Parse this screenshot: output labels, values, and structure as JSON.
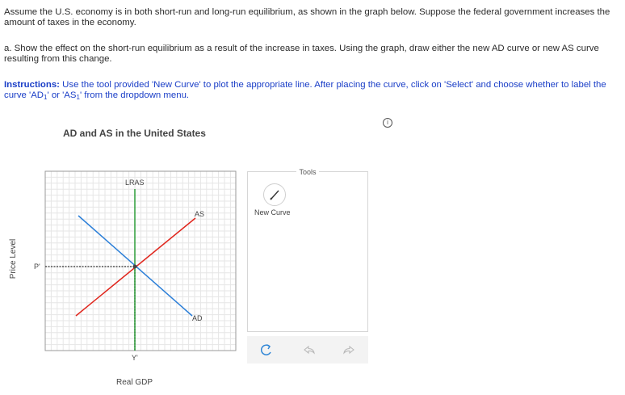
{
  "question": {
    "intro": "Assume the U.S. economy is in both short-run and long-run equilibrium, as shown in the graph below. Suppose the federal government increases the amount of taxes in the economy.",
    "part_a": "a. Show the effect on the short-run equilibrium as a result of the increase in taxes. Using the graph, draw either the new AD curve or new AS curve resulting from this change.",
    "instructions_label": "Instructions:",
    "instructions_text_1": " Use the tool provided 'New Curve' to plot the appropriate line. After placing the curve, click on 'Select' and choose whether to label the curve 'AD",
    "instructions_text_2": "' or 'AS",
    "instructions_text_3": "' from the dropdown menu.",
    "sub_index": "1"
  },
  "info_icon": "i",
  "graph": {
    "title": "AD and AS in the United States",
    "ylabel": "Price Level",
    "xlabel": "Real GDP",
    "lras_label": "LRAS",
    "as_label": "AS",
    "ad_label": "AD",
    "p_label": "P'",
    "y_label": "Y'"
  },
  "tools": {
    "title": "Tools",
    "new_curve_label": "New Curve"
  },
  "colors": {
    "lras": "#2e9e3a",
    "as": "#e0271e",
    "ad": "#2c7fd8",
    "instructions": "#1a3ec7",
    "toolbar_icons": "#2f86d6"
  },
  "icons": [
    "info-icon",
    "pencil-icon",
    "reset-icon",
    "undo-icon",
    "redo-icon"
  ]
}
